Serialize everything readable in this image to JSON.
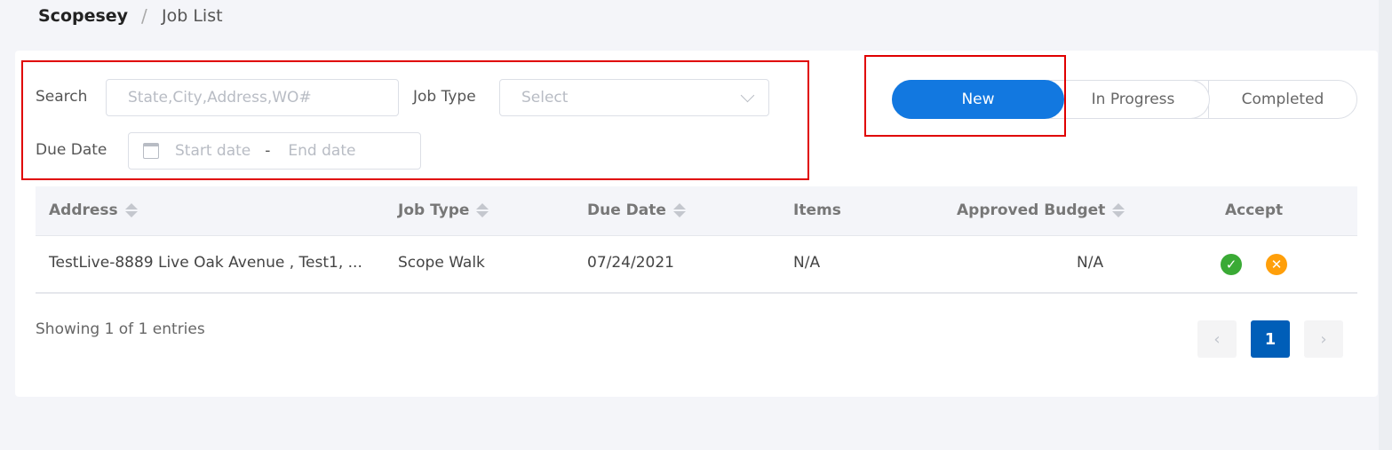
{
  "breadcrumb": {
    "root": "Scopesey",
    "separator": "/",
    "current": "Job List"
  },
  "filters": {
    "search_label": "Search",
    "search_placeholder": "State,City,Address,WO#",
    "job_type_label": "Job Type",
    "job_type_placeholder": "Select",
    "due_date_label": "Due Date",
    "start_placeholder": "Start date",
    "date_separator": "-",
    "end_placeholder": "End date"
  },
  "status_tabs": [
    {
      "label": "New",
      "active": true
    },
    {
      "label": "In Progress",
      "active": false
    },
    {
      "label": "Completed",
      "active": false
    }
  ],
  "table": {
    "columns": [
      "Address",
      "Job Type",
      "Due Date",
      "Items",
      "Approved Budget",
      "Accept"
    ],
    "rows": [
      {
        "address": "TestLive-8889 Live Oak Avenue , Test1, ...",
        "job_type": "Scope Walk",
        "due_date": "07/24/2021",
        "items": "N/A",
        "approved_budget": "N/A"
      }
    ]
  },
  "footer": {
    "entries_text": "Showing 1 of 1 entries",
    "current_page": "1",
    "prev": "‹",
    "next": "›"
  },
  "colors": {
    "accent": "#1278e0",
    "page_active": "#005eb8",
    "accept": "#3aaa35",
    "reject": "#ff9f0a",
    "highlight": "#e00000"
  }
}
